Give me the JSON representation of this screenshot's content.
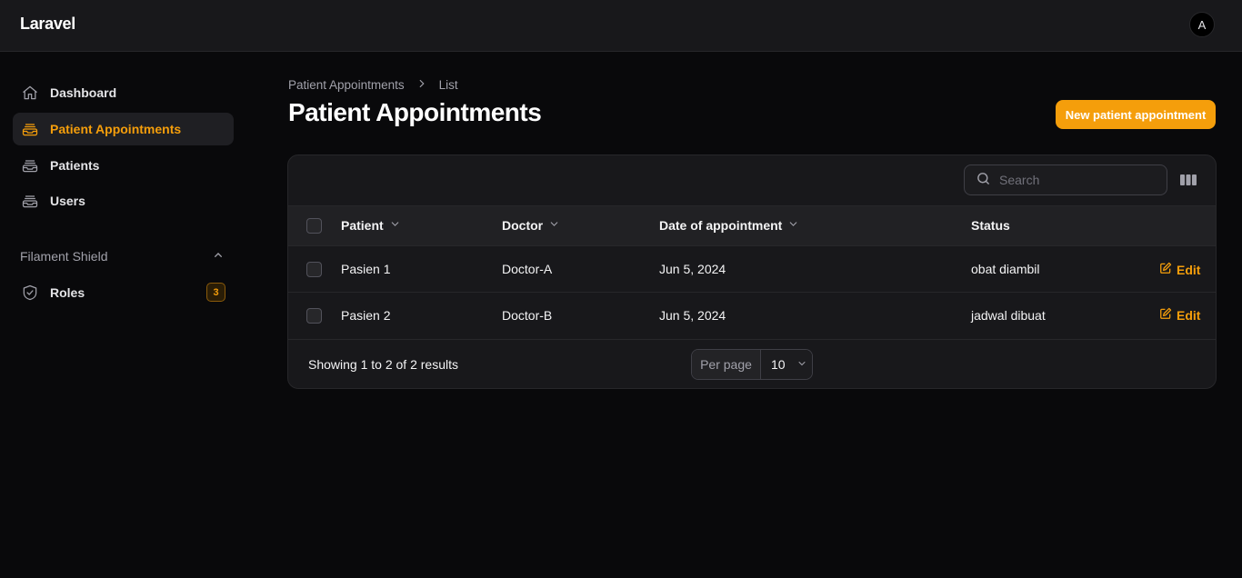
{
  "app": {
    "brand": "Laravel",
    "avatar_initial": "A"
  },
  "sidebar": {
    "items": [
      {
        "label": "Dashboard",
        "icon": "home-icon",
        "active": false
      },
      {
        "label": "Patient Appointments",
        "icon": "inbox-stack-icon",
        "active": true
      },
      {
        "label": "Patients",
        "icon": "inbox-stack-icon",
        "active": false
      },
      {
        "label": "Users",
        "icon": "inbox-stack-icon",
        "active": false
      }
    ],
    "group": {
      "label": "Filament Shield",
      "items": [
        {
          "label": "Roles",
          "icon": "shield-check-icon",
          "badge": "3"
        }
      ]
    }
  },
  "breadcrumb": {
    "parent": "Patient Appointments",
    "current": "List"
  },
  "page": {
    "title": "Patient Appointments",
    "create_button": "New patient appointment"
  },
  "table": {
    "search_placeholder": "Search",
    "columns": [
      "Patient",
      "Doctor",
      "Date of appointment",
      "Status"
    ],
    "rows": [
      {
        "patient": "Pasien 1",
        "doctor": "Doctor-A",
        "date": "Jun 5, 2024",
        "status": "obat diambil",
        "action": "Edit"
      },
      {
        "patient": "Pasien 2",
        "doctor": "Doctor-B",
        "date": "Jun 5, 2024",
        "status": "jadwal dibuat",
        "action": "Edit"
      }
    ],
    "footer": {
      "results_text": "Showing 1 to 2 of 2 results",
      "per_page_label": "Per page",
      "per_page_value": "10"
    }
  },
  "colors": {
    "accent": "#f59e0b",
    "background": "#09090b",
    "surface": "#18181b"
  }
}
